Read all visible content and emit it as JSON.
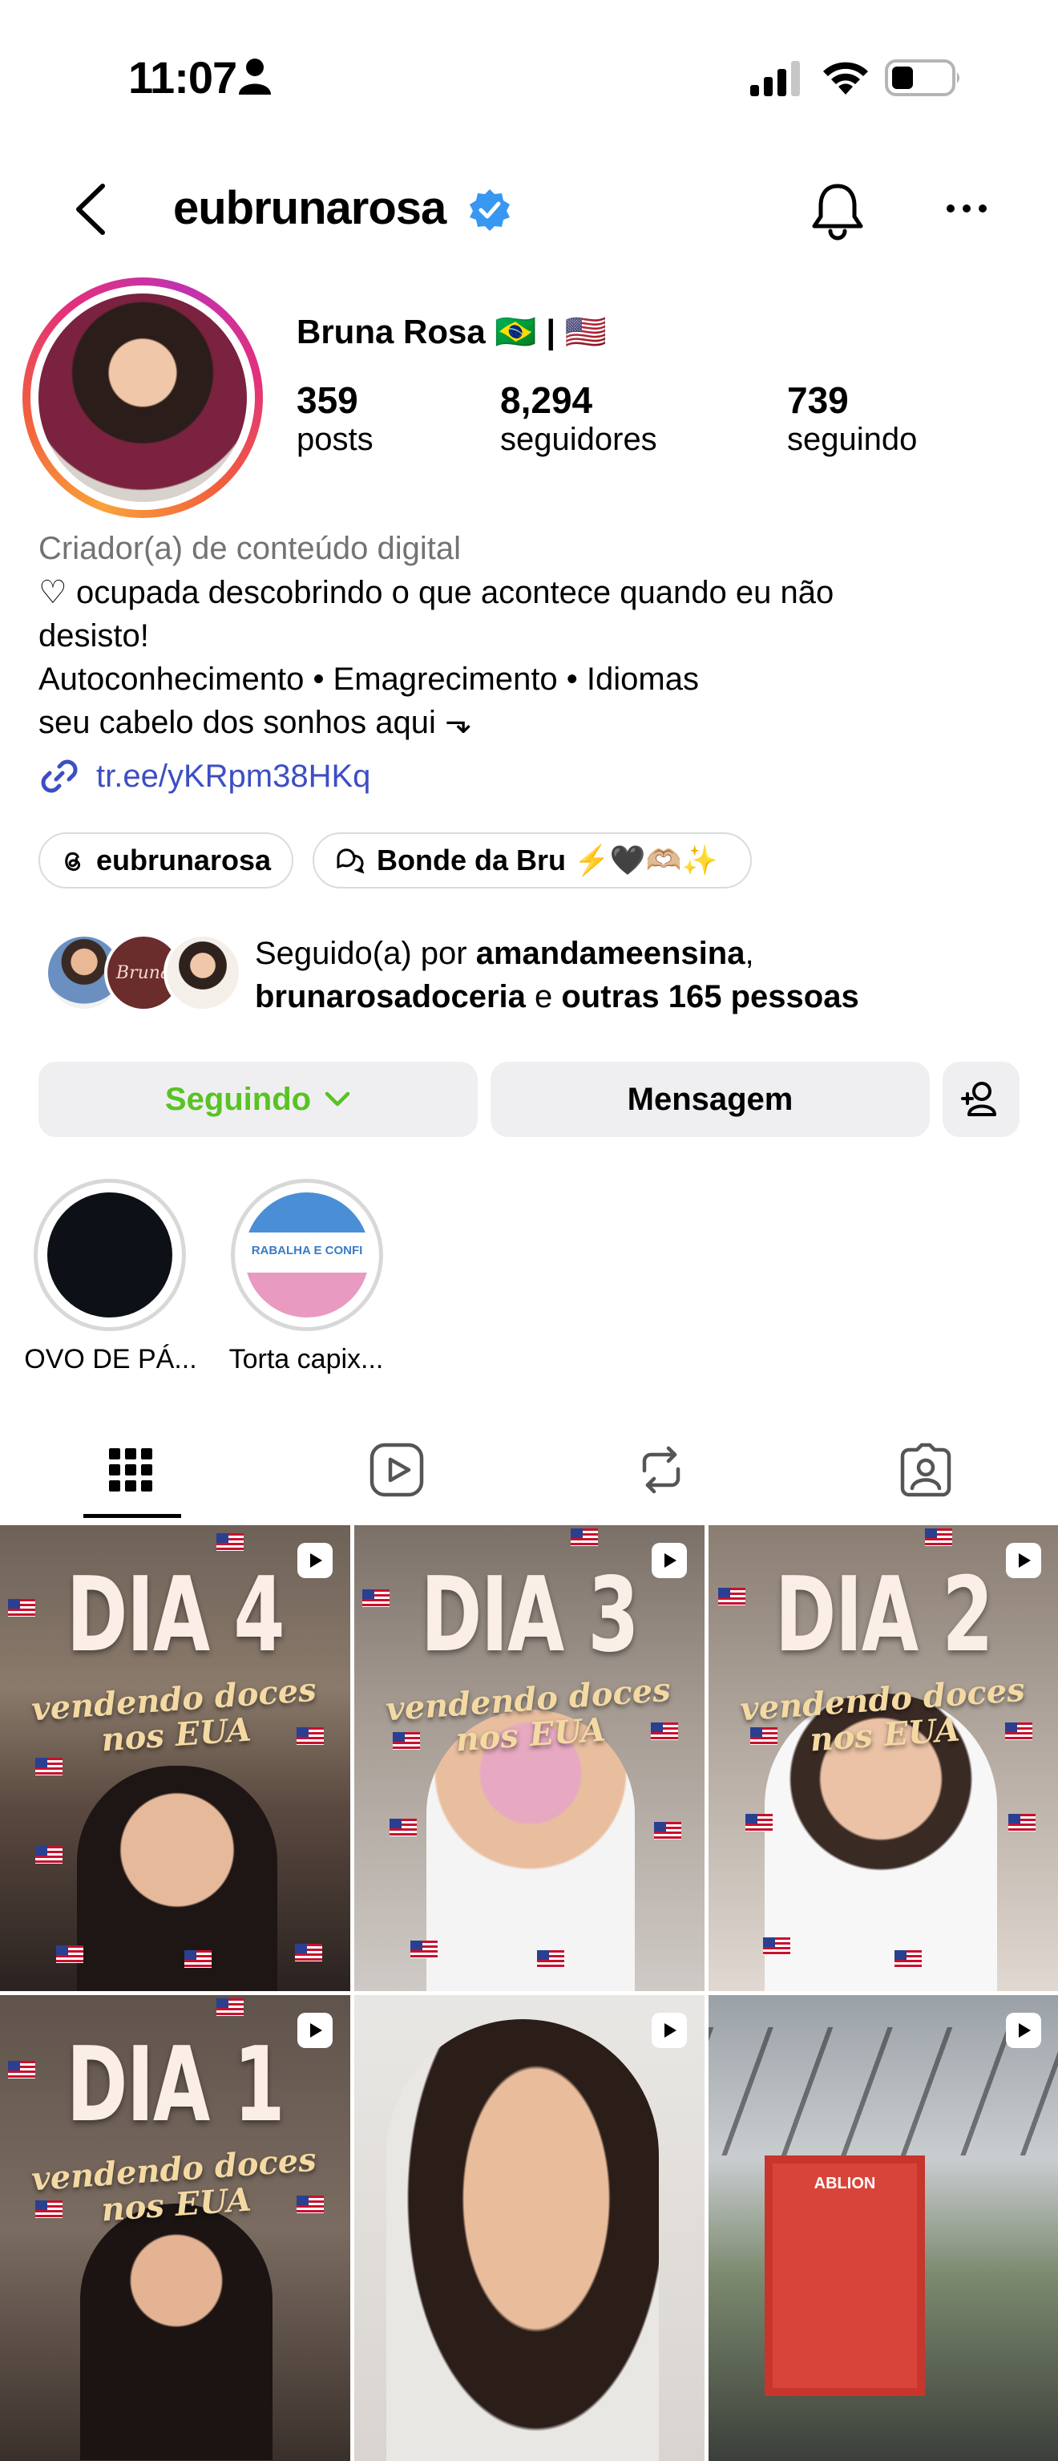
{
  "status_bar": {
    "time": "11:07"
  },
  "header": {
    "username": "eubrunarosa"
  },
  "profile": {
    "name": "Bruna Rosa 🇧🇷 | 🇺🇸",
    "stats": [
      {
        "value": "359",
        "label": "posts"
      },
      {
        "value": "8,294",
        "label": "seguidores"
      },
      {
        "value": "739",
        "label": "seguindo"
      }
    ],
    "category": "Criador(a) de conteúdo digital",
    "bio_lines": [
      "♡ ocupada descobrindo o que acontece quando eu não",
      "desisto!",
      "Autoconhecimento • Emagrecimento • Idiomas",
      "seu cabelo dos sonhos aqui ⬎"
    ],
    "link": "tr.ee/yKRpm38HKq"
  },
  "chips": [
    {
      "label": "eubrunarosa",
      "icon": "threads-icon"
    },
    {
      "label": "Bonde da Bru ⚡️🖤🫶🏼✨",
      "icon": "chat-bubbles-icon"
    }
  ],
  "followed_by": {
    "prefix": "Seguido(a) por ",
    "user1": "amandameensina",
    "sep": ",",
    "user2": "brunarosadoceria",
    "conj": " e ",
    "others": "outras 165 pessoas"
  },
  "actions": {
    "following": "Seguindo",
    "message": "Mensagem"
  },
  "highlights": [
    {
      "label": "OVO DE PÁ..."
    },
    {
      "label": "Torta capix...",
      "sticker_text": "RABALHA E CONFI"
    }
  ],
  "tabs": [
    "grid-icon",
    "reels-icon",
    "reposts-icon",
    "tagged-icon"
  ],
  "posts": [
    {
      "title": "DIA 4",
      "subtitle": "vendendo doces nos EUA"
    },
    {
      "title": "DIA 3",
      "subtitle": "vendendo doces nos EUA"
    },
    {
      "title": "DIA 2",
      "subtitle": "vendendo doces nos EUA"
    },
    {
      "title": "DIA 1",
      "subtitle": "vendendo doces nos EUA"
    },
    {
      "title": "",
      "subtitle": ""
    },
    {
      "title": "",
      "subtitle": "",
      "sign": "ABLION"
    }
  ],
  "colors": {
    "following_green": "#58c322",
    "link_blue": "#3d4ec4",
    "verified_blue": "#3897f0",
    "button_bg": "#efeff1"
  }
}
